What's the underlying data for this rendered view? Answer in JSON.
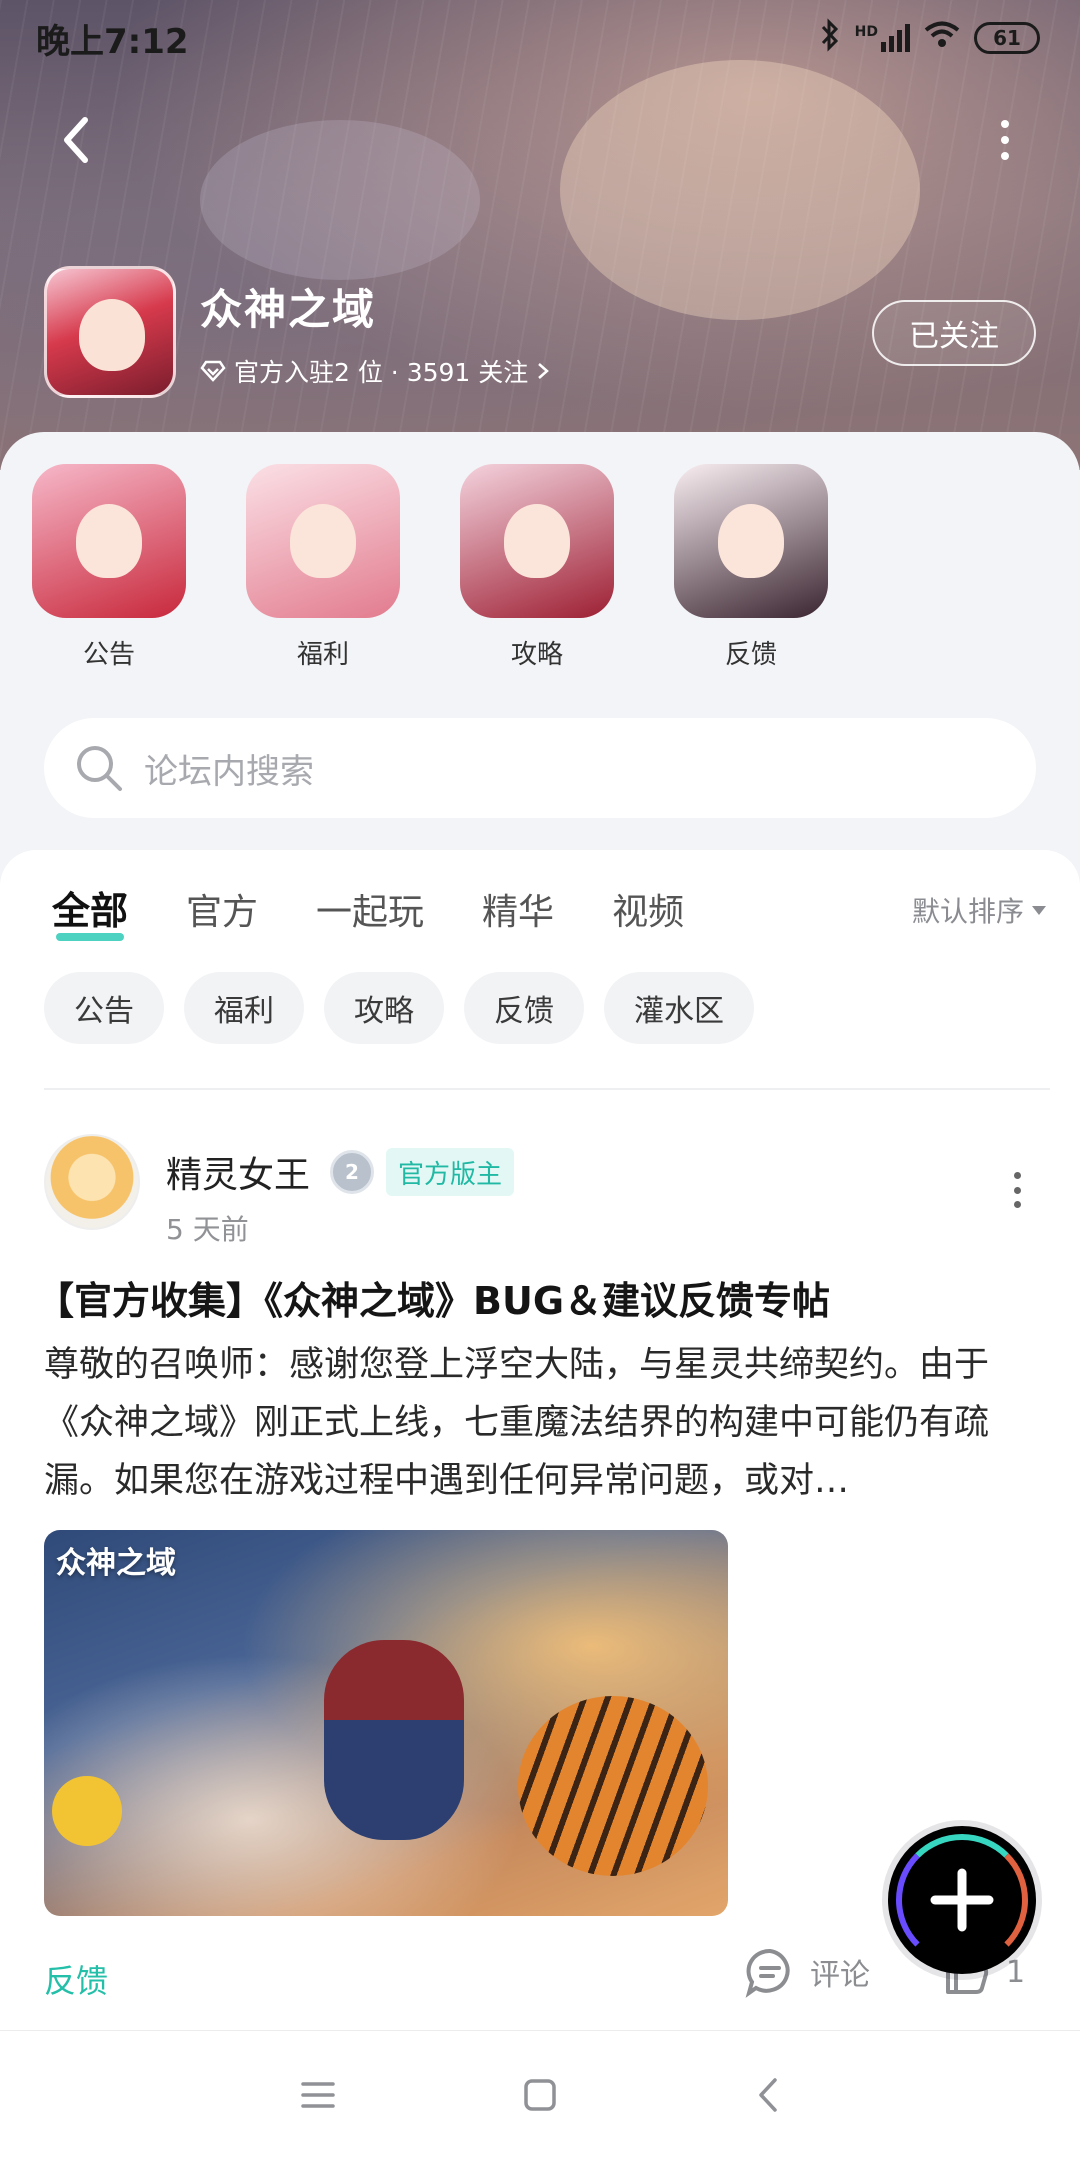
{
  "status_bar": {
    "time": "晚上7:12",
    "hd_label": "HD",
    "battery": "61"
  },
  "header": {
    "game_title": "众神之域",
    "meta_text": "官方入驻2 位 · 3591 关注",
    "follow_button": "已关注"
  },
  "quick_links": [
    {
      "label": "公告",
      "colors": [
        "#f6b8c9",
        "#c8283b"
      ]
    },
    {
      "label": "福利",
      "colors": [
        "#fbe0e6",
        "#e27b8e"
      ]
    },
    {
      "label": "攻略",
      "colors": [
        "#f4d3de",
        "#9d1f33"
      ]
    },
    {
      "label": "反馈",
      "colors": [
        "#f9eef2",
        "#3a2530"
      ]
    }
  ],
  "search": {
    "placeholder": "论坛内搜索"
  },
  "tabs": [
    {
      "label": "全部",
      "active": true
    },
    {
      "label": "官方",
      "active": false
    },
    {
      "label": "一起玩",
      "active": false
    },
    {
      "label": "精华",
      "active": false
    },
    {
      "label": "视频",
      "active": false
    }
  ],
  "sort_label": "默认排序",
  "chips": [
    "公告",
    "福利",
    "攻略",
    "反馈",
    "灌水区"
  ],
  "post": {
    "author": "精灵女王",
    "level": "2",
    "official_tag": "官方版主",
    "time": "5 天前",
    "title": "【官方收集】《众神之域》BUG＆建议反馈专帖",
    "body": "尊敬的召唤师：感谢您登上浮空大陆，与星灵共缔契约。由于《众神之域》刚正式上线，七重魔法结界的构建中可能仍有疏漏。如果您在游戏过程中遇到任何异常问题，或对…",
    "image_caption": "众神之域",
    "tag": "反馈",
    "comment_label": "评论",
    "like_count": "1"
  },
  "colors": {
    "accent": "#2ec9b6",
    "tag_text": "#23bfa8",
    "official_bg": "#e3f8f4"
  }
}
